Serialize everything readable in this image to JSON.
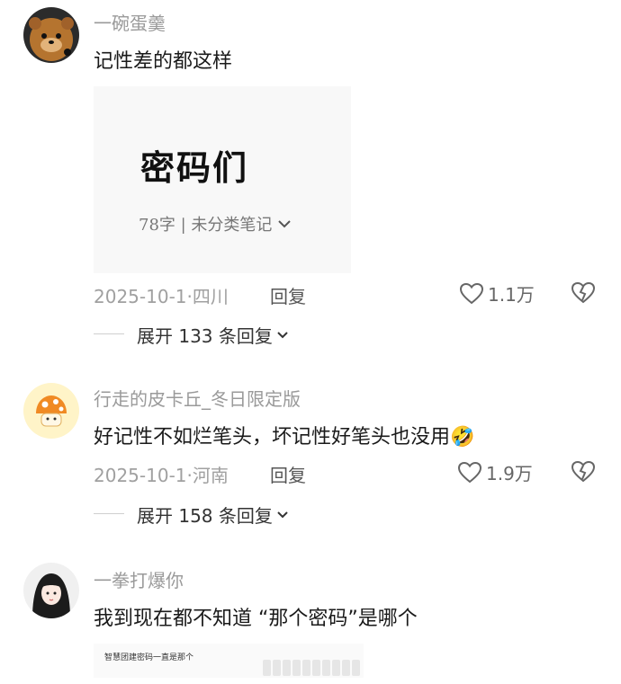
{
  "comments": [
    {
      "username": "一碗蛋羹",
      "text": "记性差的都这样",
      "note": {
        "title": "密码们",
        "meta": "78字 | 未分类笔记"
      },
      "date": "2025-10-1·四川",
      "reply_label": "回复",
      "likes": "1.1万",
      "expand_label": "展开 133 条回复"
    },
    {
      "username": "行走的皮卡丘_冬日限定版",
      "text": "好记性不如烂笔头，坏记性好笔头也没用",
      "emoji": "🤣",
      "date": "2025-10-1·河南",
      "reply_label": "回复",
      "likes": "1.9万",
      "expand_label": "展开 158 条回复"
    },
    {
      "username": "一拳打爆你",
      "text": "我到现在都不知道 “那个密码”是哪个",
      "image_caption": "智慧团建密码一直是那个"
    }
  ],
  "icons": {
    "like": "heart-outline-icon",
    "dislike": "broken-heart-icon",
    "expand": "chevron-down-icon"
  },
  "colors": {
    "meta": "#a0a0a0",
    "username": "#9a9a9a",
    "text": "#1a1a1a"
  }
}
